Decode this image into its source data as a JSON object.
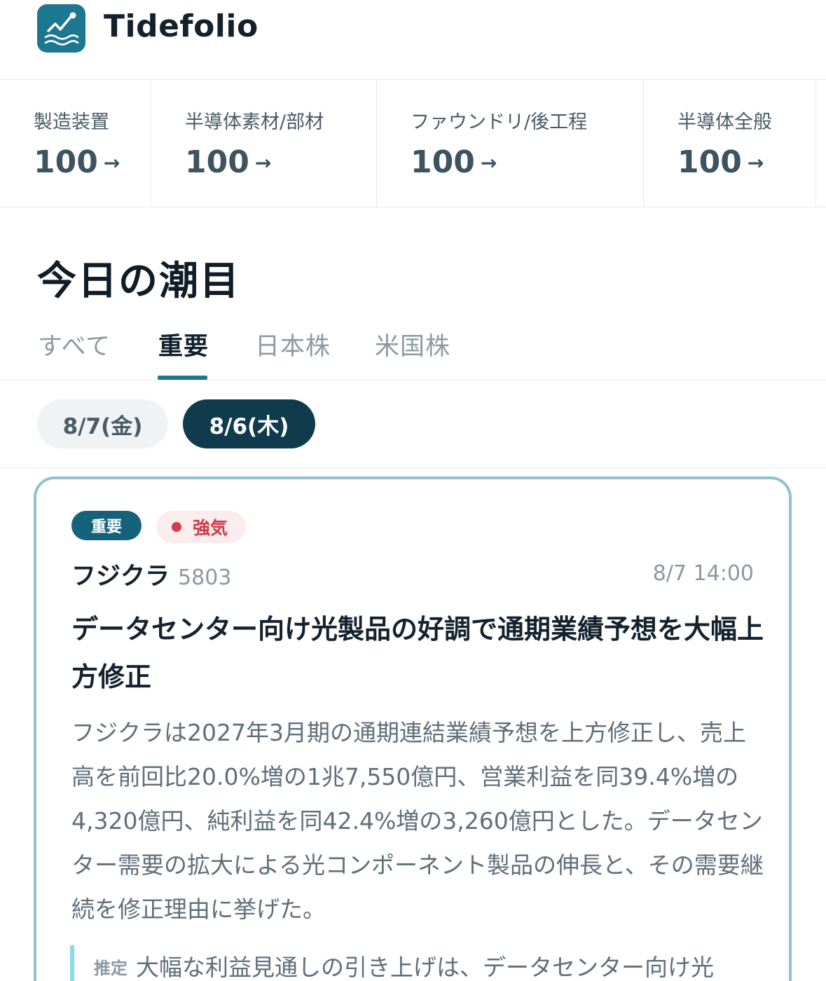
{
  "app": {
    "title": "Tidefolio",
    "accent_color": "#1e7791",
    "logo_icon": "trend-line-wave-icon"
  },
  "sectors": [
    {
      "name": "製造装置",
      "value": "100"
    },
    {
      "name": "半導体素材/部材",
      "value": "100"
    },
    {
      "name": "ファウンドリ/後工程",
      "value": "100"
    },
    {
      "name": "半導体全般",
      "value": "100"
    }
  ],
  "sector_arrow": "→",
  "section": {
    "title": "今日の潮目"
  },
  "tabs": [
    {
      "label": "すべて",
      "active": false
    },
    {
      "label": "重要",
      "active": true
    },
    {
      "label": "日本株",
      "active": false
    },
    {
      "label": "米国株",
      "active": false
    }
  ],
  "dates": [
    {
      "label": "8/7(金)",
      "active": false
    },
    {
      "label": "8/6(木)",
      "active": true
    }
  ],
  "card": {
    "badge_important": "重要",
    "badge_sentiment": "強気",
    "sentiment_color": "#d73a49",
    "company": "フジクラ",
    "ticker": "5803",
    "timestamp": "8/7 14:00",
    "headline": "データセンター向け光製品の好調で通期業績予想を大幅上方修正",
    "body": "フジクラは2027年3月期の通期連結業績予想を上方修正し、売上高を前回比20.0%増の1兆7,550億円、営業利益を同39.4%増の4,320億円、純利益を同42.4%増の3,260億円とした。データセンター需要の拡大による光コンポーネント製品の伸長と、その需要継続を修正理由に挙げた。",
    "estimate_label": "推定",
    "estimate_text": "大幅な利益見通しの引き上げは、データセンター向け光"
  }
}
